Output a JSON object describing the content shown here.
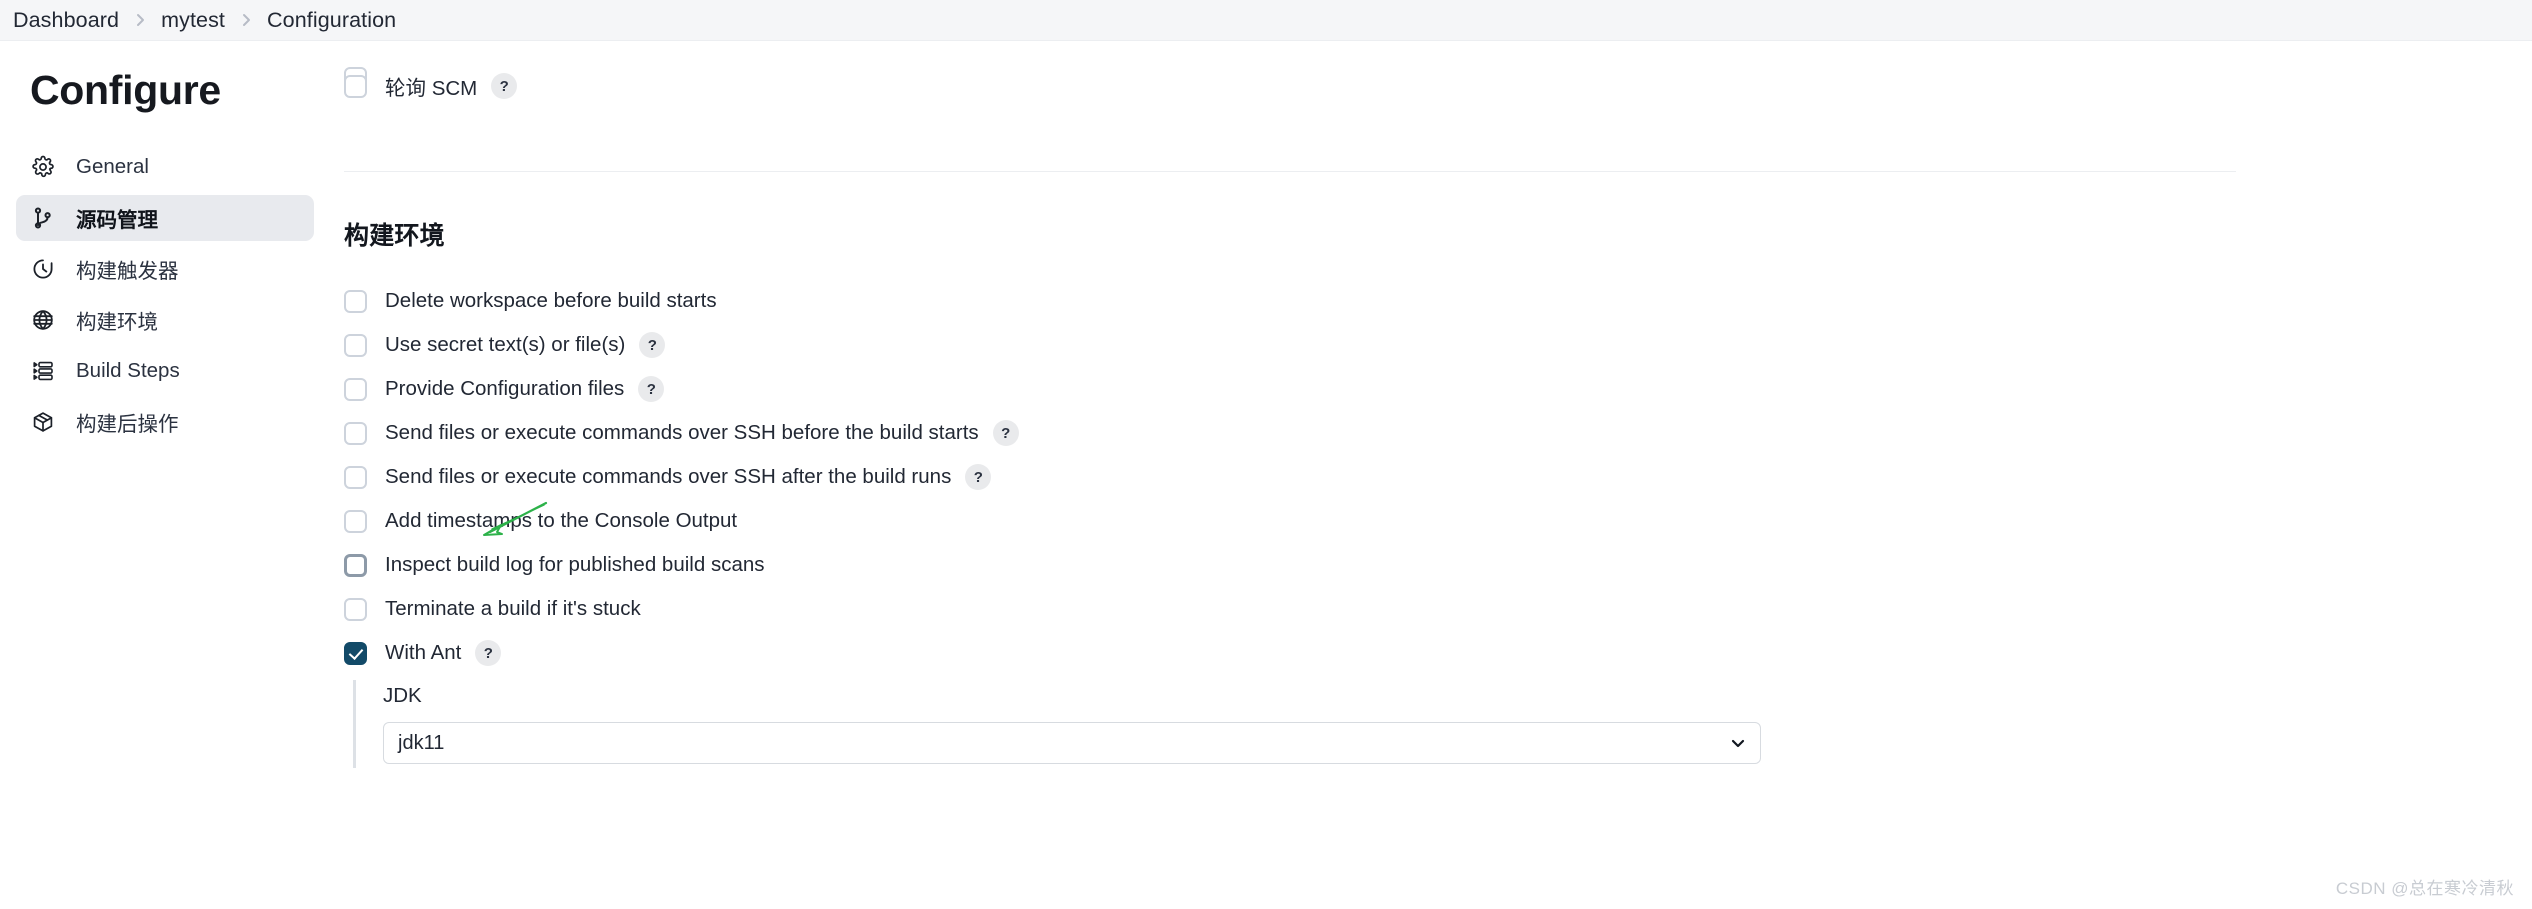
{
  "breadcrumb": {
    "items": [
      {
        "label": "Dashboard"
      },
      {
        "label": "mytest"
      },
      {
        "label": "Configuration"
      }
    ]
  },
  "sidebar": {
    "title": "Configure",
    "items": [
      {
        "label": "General",
        "icon": "gear-icon",
        "active": false
      },
      {
        "label": "源码管理",
        "icon": "git-branch-icon",
        "active": true
      },
      {
        "label": "构建触发器",
        "icon": "clock-icon",
        "active": false
      },
      {
        "label": "构建环境",
        "icon": "globe-icon",
        "active": false
      },
      {
        "label": "Build Steps",
        "icon": "list-steps-icon",
        "active": false
      },
      {
        "label": "构建后操作",
        "icon": "package-icon",
        "active": false
      }
    ]
  },
  "main": {
    "scrolled_section": {
      "poll_scm_label": "轮询 SCM",
      "poll_scm_checked": false,
      "poll_scm_help": "?"
    },
    "build_env": {
      "heading": "构建环境",
      "checkboxes": [
        {
          "label": "Delete workspace before build starts",
          "checked": false,
          "help": false,
          "state": "normal"
        },
        {
          "label": "Use secret text(s) or file(s)",
          "checked": false,
          "help": true,
          "state": "normal"
        },
        {
          "label": "Provide Configuration files",
          "checked": false,
          "help": true,
          "state": "normal"
        },
        {
          "label": "Send files or execute commands over SSH before the build starts",
          "checked": false,
          "help": true,
          "state": "normal"
        },
        {
          "label": "Send files or execute commands over SSH after the build runs",
          "checked": false,
          "help": true,
          "state": "normal"
        },
        {
          "label": "Add timestamps to the Console Output",
          "checked": false,
          "help": false,
          "state": "normal"
        },
        {
          "label": "Inspect build log for published build scans",
          "checked": false,
          "help": false,
          "state": "hovered"
        },
        {
          "label": "Terminate a build if it's stuck",
          "checked": false,
          "help": false,
          "state": "normal"
        },
        {
          "label": "With Ant",
          "checked": true,
          "help": true,
          "state": "normal"
        }
      ],
      "help_badge_text": "?",
      "jdk": {
        "field_label": "JDK",
        "selected_value": "jdk11",
        "options": [
          "jdk11"
        ],
        "chevron": "chevron-down-icon"
      }
    }
  },
  "annotation": {
    "arrow_color": "#2db24a",
    "name": "green-annotation-arrow"
  },
  "watermark": {
    "text": "CSDN @总在寒冷清秋"
  },
  "colors": {
    "accent_checked": "#124a68",
    "breadcrumb_bg": "#f5f6f8",
    "sidebar_active_bg": "#e8eaee",
    "divider": "#eceef1",
    "help_badge_bg": "#e9eaec",
    "watermark": "#c8ccd2"
  }
}
